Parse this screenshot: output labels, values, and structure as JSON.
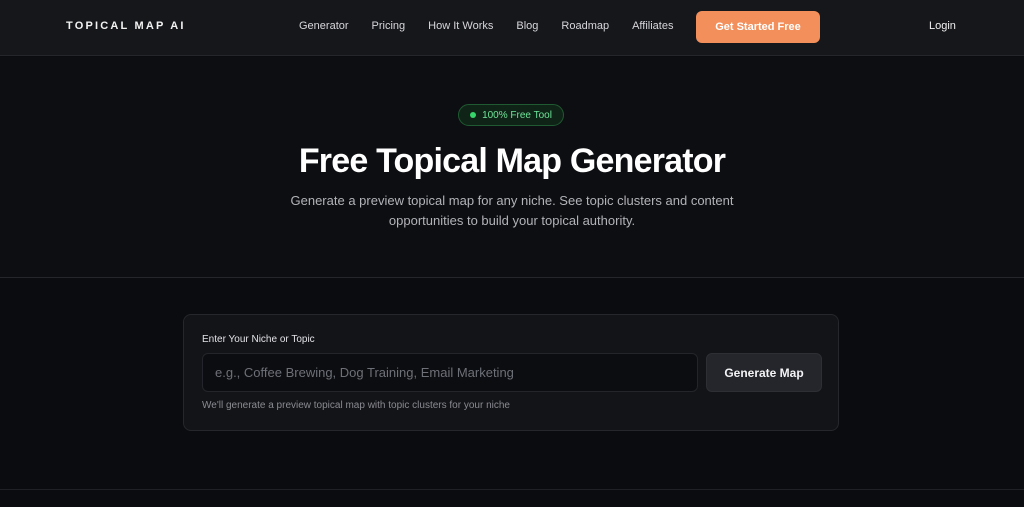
{
  "nav": {
    "logo": "TOPICAL MAP AI",
    "links": [
      "Generator",
      "Pricing",
      "How It Works",
      "Blog",
      "Roadmap",
      "Affiliates"
    ],
    "cta_label": "Get Started Free",
    "login_label": "Login"
  },
  "hero": {
    "badge": "100% Free Tool",
    "title": "Free Topical Map Generator",
    "subtitle": "Generate a preview topical map for any niche. See topic clusters and content opportunities to build your topical authority."
  },
  "form": {
    "label": "Enter Your Niche or Topic",
    "input_value": "",
    "placeholder": "e.g., Coffee Brewing, Dog Training, Email Marketing",
    "button_label": "Generate Map",
    "helper": "We'll generate a preview topical map with topic clusters for your niche"
  },
  "colors": {
    "accent": "#f28f5b",
    "badge_green": "#37d36b",
    "background": "#0b0c0f"
  }
}
